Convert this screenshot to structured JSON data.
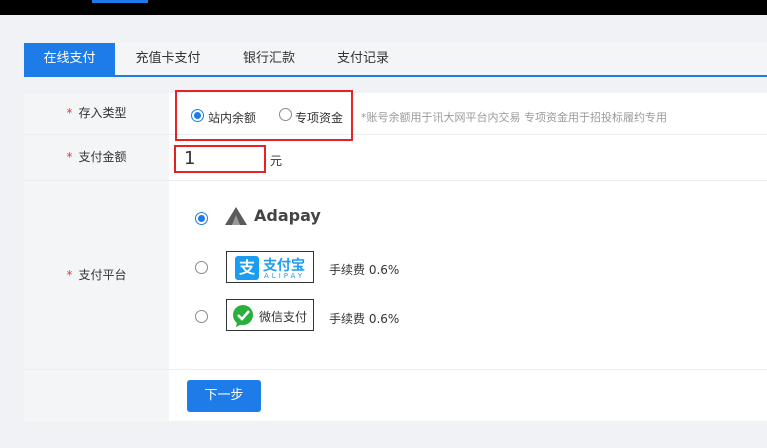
{
  "tabs": [
    {
      "label": "在线支付"
    },
    {
      "label": "充值卡支付"
    },
    {
      "label": "银行汇款"
    },
    {
      "label": "支付记录"
    }
  ],
  "form": {
    "required_mark": "*",
    "deposit_type": {
      "label": "存入类型",
      "options": [
        {
          "label": "站内余额",
          "selected": true
        },
        {
          "label": "专项资金",
          "selected": false
        }
      ],
      "note": "*账号余额用于讯大网平台内交易 专项资金用于招投标履约专用"
    },
    "amount": {
      "label": "支付金额",
      "value": "1",
      "unit": "元"
    },
    "platform": {
      "label": "支付平台",
      "options": [
        {
          "name": "Adapay",
          "selected": true,
          "fee": ""
        },
        {
          "name": "支付宝",
          "sub": "ALIPAY",
          "selected": false,
          "fee": "手续费 0.6%"
        },
        {
          "name": "微信支付",
          "selected": false,
          "fee": "手续费 0.6%"
        }
      ]
    },
    "next_label": "下一步"
  },
  "colors": {
    "accent": "#1e7ce8",
    "highlight": "#e42424",
    "alipay": "#1b9cf0",
    "wechat": "#2aae3e"
  }
}
